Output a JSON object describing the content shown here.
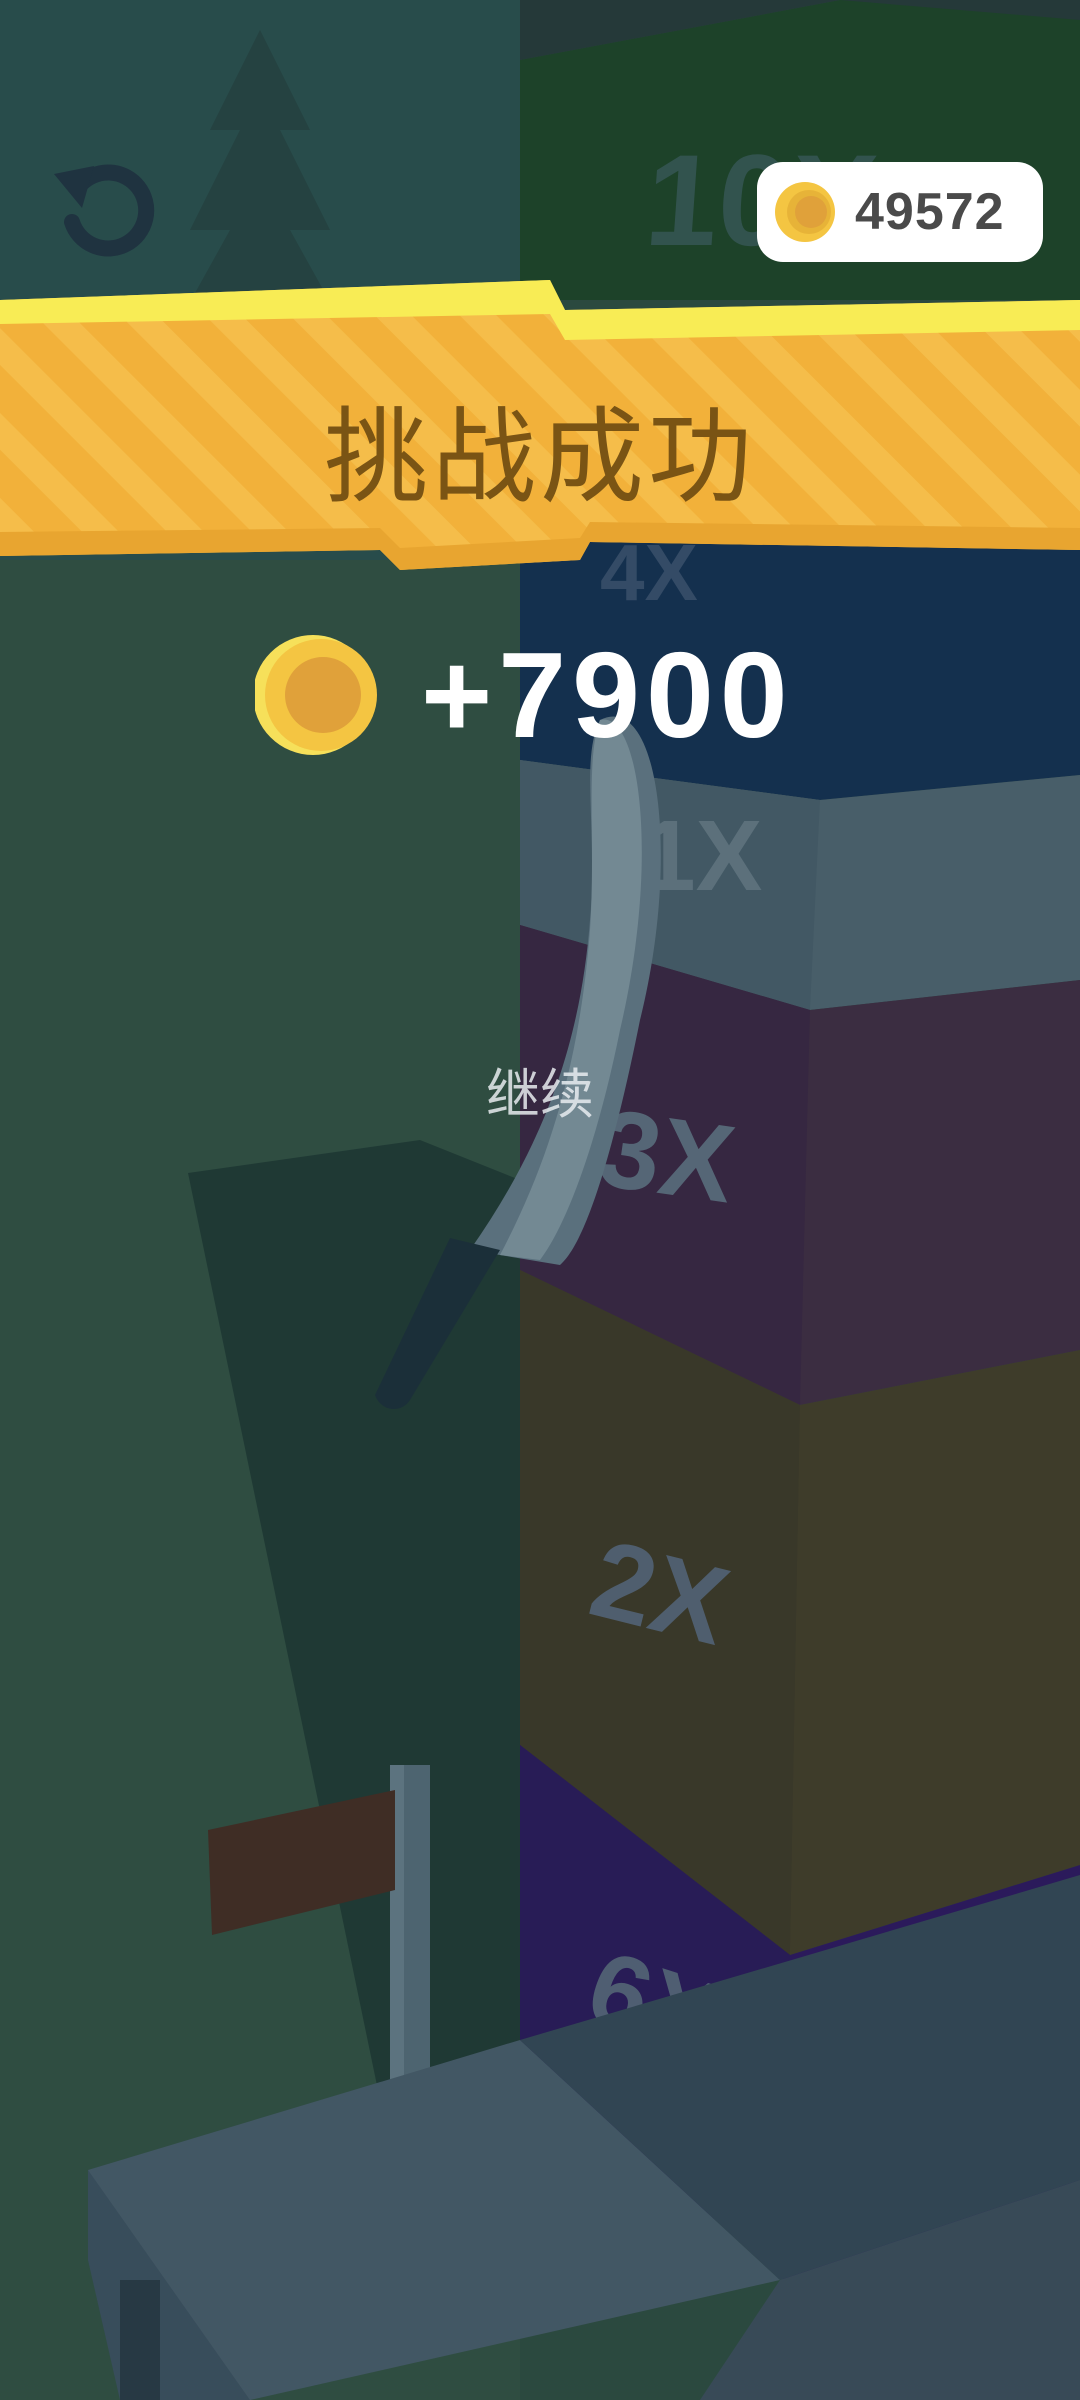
{
  "hud": {
    "restart_icon": "restart-icon",
    "coin_icon": "coin-icon",
    "coin_total": "49572"
  },
  "result": {
    "title": "挑战成功",
    "reward_icon": "coin-icon",
    "reward_amount": "+7900",
    "continue_label": "继续"
  },
  "tower": {
    "blocks": [
      {
        "label": "10X",
        "color": "#1f4a2c"
      },
      {
        "label": "4X",
        "color": "#163459"
      },
      {
        "label": "1X",
        "color": "#546a7a"
      },
      {
        "label": "3X",
        "color": "#46304a"
      },
      {
        "label": "2X",
        "color": "#4a432e"
      },
      {
        "label": "6X",
        "color": "#2f1b63"
      }
    ]
  },
  "colors": {
    "banner": "#f3b53c",
    "banner_highlight": "#f8ec55",
    "title_text": "#7a5414",
    "coin": "#f4c542",
    "coin_inner": "#e0a13a"
  }
}
